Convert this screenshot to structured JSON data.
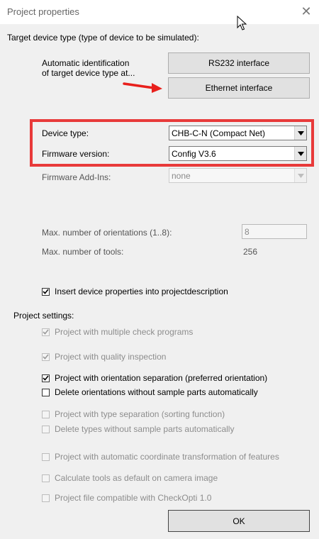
{
  "window": {
    "title": "Project properties"
  },
  "target": {
    "header": "Target device type (type of device to be simulated):",
    "auto_line1": "Automatic identification",
    "auto_line2": "of target device type at...",
    "rs232_label": "RS232 interface",
    "ethernet_label": "Ethernet interface"
  },
  "device": {
    "type_label": "Device type:",
    "type_value": "CHB-C-N (Compact Net)",
    "firmware_label": "Firmware version:",
    "firmware_value": "Config V3.6",
    "addins_label": "Firmware Add-Ins:",
    "addins_value": "none"
  },
  "limits": {
    "orient_label": "Max. number of orientations (1..8):",
    "orient_value": "8",
    "tools_label": "Max. number of tools:",
    "tools_value": "256"
  },
  "insert_props": {
    "label": "Insert device properties into projectdescription",
    "checked": true
  },
  "settings": {
    "header": "Project settings:",
    "items": [
      {
        "label": "Project with multiple check programs",
        "checked": true,
        "enabled": false
      },
      {
        "label": "Project with quality inspection",
        "checked": true,
        "enabled": false
      },
      {
        "label": "Project with orientation separation (preferred orientation)",
        "checked": true,
        "enabled": true
      },
      {
        "label": "Delete orientations without sample parts automatically",
        "checked": false,
        "enabled": true
      },
      {
        "label": "Project with type separation (sorting function)",
        "checked": false,
        "enabled": false
      },
      {
        "label": "Delete types without sample parts automatically",
        "checked": false,
        "enabled": false
      },
      {
        "label": "Project with automatic coordinate transformation of features",
        "checked": false,
        "enabled": false
      },
      {
        "label": "Calculate tools as default on camera image",
        "checked": false,
        "enabled": false
      },
      {
        "label": "Project file compatible with CheckOpti 1.0",
        "checked": false,
        "enabled": false
      }
    ]
  },
  "ok_label": "OK",
  "colors": {
    "highlight": "#e83a3a",
    "arrow": "#e8201c"
  },
  "icons": [
    "close-icon",
    "cursor-icon",
    "dropdown-arrow-icon",
    "checkmark-icon",
    "red-arrow-icon"
  ]
}
